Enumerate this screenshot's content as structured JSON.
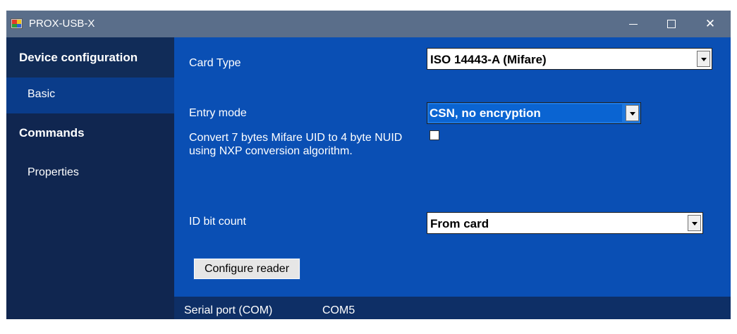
{
  "window": {
    "title": "PROX-USB-X",
    "icon": "app-grid-icon",
    "controls": {
      "minimize": "minimize-icon",
      "maximize": "maximize-icon",
      "close_label": "✕"
    }
  },
  "sidebar": {
    "items": [
      {
        "label": "Device configuration",
        "kind": "header"
      },
      {
        "label": "Basic",
        "kind": "sub",
        "selected": true
      },
      {
        "label": "Commands",
        "kind": "header"
      },
      {
        "label": "Properties",
        "kind": "sub"
      }
    ]
  },
  "form": {
    "card_type": {
      "label": "Card Type",
      "value": "ISO 14443-A (Mifare)"
    },
    "entry_mode": {
      "label": "Entry mode",
      "value": "CSN, no encryption"
    },
    "convert": {
      "label": "Convert 7 bytes Mifare UID to 4 byte NUID using NXP conversion algorithm.",
      "checked": false
    },
    "id_bit_count": {
      "label": "ID bit count",
      "value": "From card"
    },
    "configure_button": "Configure reader"
  },
  "status": {
    "label": "Serial port (COM)",
    "value": "COM5"
  },
  "colors": {
    "titlebar": "#5a6e8a",
    "sidebar": "#102650",
    "sidebar_selected": "#0a3c8a",
    "content": "#0a4fb4",
    "statusbar": "#0e2f66"
  }
}
